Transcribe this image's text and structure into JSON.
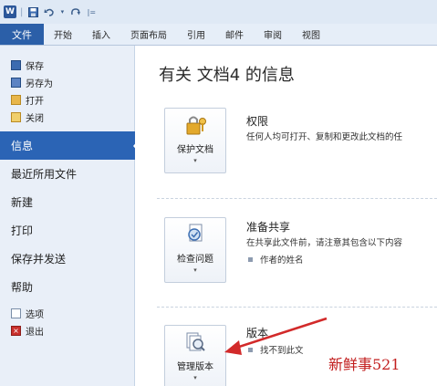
{
  "quick_access": {
    "app_icon": "word-icon",
    "app_letter": "W",
    "tools": [
      "save-icon",
      "undo-icon",
      "redo-icon",
      "customize-icon"
    ]
  },
  "ribbon_tabs": [
    "文件",
    "开始",
    "插入",
    "页面布局",
    "引用",
    "邮件",
    "审阅",
    "视图"
  ],
  "nav": {
    "small_top": [
      {
        "label": "保存",
        "icon": "save-icon"
      },
      {
        "label": "另存为",
        "icon": "save-as-icon"
      },
      {
        "label": "打开",
        "icon": "open-folder-icon"
      },
      {
        "label": "关闭",
        "icon": "close-folder-icon"
      }
    ],
    "big": [
      {
        "label": "信息",
        "active": true
      },
      {
        "label": "最近所用文件"
      },
      {
        "label": "新建"
      },
      {
        "label": "打印"
      },
      {
        "label": "保存并发送"
      },
      {
        "label": "帮助"
      }
    ],
    "small_bottom": [
      {
        "label": "选项",
        "icon": "options-icon"
      },
      {
        "label": "退出",
        "icon": "exit-icon"
      }
    ]
  },
  "main": {
    "title": "有关 文档4 的信息",
    "sections": [
      {
        "button_label": "保护文档",
        "button_icon": "lock-key-icon",
        "title": "权限",
        "description": "任何人均可打开、复制和更改此文档的任"
      },
      {
        "button_label": "检查问题",
        "button_icon": "inspect-document-icon",
        "title": "准备共享",
        "description": "在共享此文件前，请注意其包含以下内容",
        "bullets": [
          "作者的姓名"
        ]
      },
      {
        "button_label": "管理版本",
        "button_icon": "manage-versions-icon",
        "title": "版本",
        "description": "找不到此文"
      }
    ]
  },
  "watermark": "新鲜事521",
  "colors": {
    "file_tab": "#2b5fa8",
    "active_nav": "#2b64b5",
    "annotation_arrow": "#d22a2a"
  }
}
